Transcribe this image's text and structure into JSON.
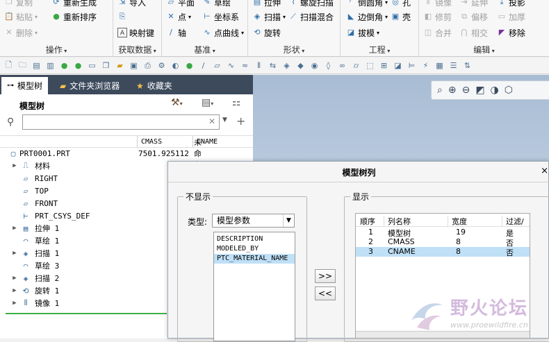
{
  "ribbon": {
    "groups": [
      {
        "label": "操作",
        "buttons": [
          {
            "label": "复制",
            "icon": "copy-icon",
            "disabled": true
          },
          {
            "label": "粘贴",
            "icon": "paste-icon",
            "disabled": true
          },
          {
            "label": "删除",
            "icon": "delete-icon",
            "disabled": true
          },
          {
            "label": "重新生成",
            "icon": "regenerate-icon",
            "disabled": false
          },
          {
            "label": "重新排序",
            "icon": "reorder-icon",
            "disabled": false
          }
        ]
      },
      {
        "label": "获取数据",
        "buttons": [
          {
            "label": "导入",
            "icon": "import-icon"
          },
          {
            "label": "",
            "icon": "data-icon"
          },
          {
            "label": "映射键",
            "icon": "mapkey-icon"
          }
        ]
      },
      {
        "label": "基准",
        "buttons": [
          {
            "label": "平面",
            "icon": "plane-icon"
          },
          {
            "label": "点",
            "icon": "point-icon"
          },
          {
            "label": "轴",
            "icon": "axis-icon"
          },
          {
            "label": "草绘",
            "icon": "sketch-icon"
          },
          {
            "label": "坐标系",
            "icon": "csys-icon"
          },
          {
            "label": "点曲线",
            "icon": "curve-icon"
          }
        ]
      },
      {
        "label": "形状",
        "buttons": [
          {
            "label": "拉伸",
            "icon": "extrude-icon"
          },
          {
            "label": "扫描",
            "icon": "sweep-icon"
          },
          {
            "label": "旋转",
            "icon": "revolve-icon"
          },
          {
            "label": "螺旋扫描",
            "icon": "helical-sweep-icon"
          },
          {
            "label": "扫描混合",
            "icon": "swept-blend-icon"
          }
        ]
      },
      {
        "label": "工程",
        "buttons": [
          {
            "label": "倒圆角",
            "icon": "round-icon"
          },
          {
            "label": "边倒角",
            "icon": "chamfer-icon"
          },
          {
            "label": "拔模",
            "icon": "draft-icon"
          },
          {
            "label": "孔",
            "icon": "hole-icon"
          },
          {
            "label": "壳",
            "icon": "shell-icon"
          }
        ]
      },
      {
        "label": "编辑",
        "buttons": [
          {
            "label": "镜像",
            "icon": "mirror-icon",
            "disabled": true
          },
          {
            "label": "修剪",
            "icon": "trim-icon",
            "disabled": true
          },
          {
            "label": "合并",
            "icon": "merge-icon",
            "disabled": true
          },
          {
            "label": "延伸",
            "icon": "extend-icon",
            "disabled": true
          },
          {
            "label": "偏移",
            "icon": "offset-icon",
            "disabled": true
          },
          {
            "label": "相交",
            "icon": "intersect-icon",
            "disabled": true
          },
          {
            "label": "投影",
            "icon": "project-icon",
            "disabled": false
          },
          {
            "label": "加厚",
            "icon": "thicken-icon",
            "disabled": true
          },
          {
            "label": "移除",
            "icon": "remove-icon",
            "disabled": false
          }
        ]
      }
    ]
  },
  "panel": {
    "tabs": [
      "模型树",
      "文件夹浏览器",
      "收藏夹"
    ],
    "tree_title": "模型树",
    "columns": [
      "CMASS",
      "CNAME"
    ],
    "root": {
      "name": "PRT0001.PRT",
      "cmass": "7501.925112",
      "cname": "未命名"
    },
    "items": [
      {
        "name": "材料",
        "icon": "material-icon",
        "expandable": true
      },
      {
        "name": "RIGHT",
        "icon": "datum-plane-icon",
        "expandable": false
      },
      {
        "name": "TOP",
        "icon": "datum-plane-icon",
        "expandable": false
      },
      {
        "name": "FRONT",
        "icon": "datum-plane-icon",
        "expandable": false
      },
      {
        "name": "PRT_CSYS_DEF",
        "icon": "csys-icon",
        "expandable": false
      },
      {
        "name": "拉伸 1",
        "icon": "extrude-icon",
        "expandable": true
      },
      {
        "name": "草绘 1",
        "icon": "sketch-icon",
        "expandable": false
      },
      {
        "name": "扫描 1",
        "icon": "sweep-icon",
        "expandable": true
      },
      {
        "name": "草绘 3",
        "icon": "sketch-icon",
        "expandable": false
      },
      {
        "name": "扫描 2",
        "icon": "sweep-icon",
        "expandable": true
      },
      {
        "name": "旋转 1",
        "icon": "revolve-icon",
        "expandable": true
      },
      {
        "name": "镜像 1",
        "icon": "mirror-icon",
        "expandable": true
      }
    ]
  },
  "dialog": {
    "title": "模型树列",
    "hidden_legend": "不显示",
    "type_label": "类型:",
    "type_value": "模型参数",
    "params": [
      "DESCRIPTION",
      "MODELED_BY",
      "PTC_MATERIAL_NAME"
    ],
    "selected_param": 2,
    "display_legend": "显示",
    "add_label": ">>",
    "remove_label": "<<",
    "table_headers": [
      "顺序",
      "列名称",
      "宽度",
      "过滤/"
    ],
    "rows": [
      {
        "order": "1",
        "name": "模型树",
        "width": "19",
        "filter": "是"
      },
      {
        "order": "2",
        "name": "CMASS",
        "width": "8",
        "filter": "否"
      },
      {
        "order": "3",
        "name": "CNAME",
        "width": "8",
        "filter": "否"
      }
    ],
    "selected_row": 2
  },
  "watermark": {
    "text": "野火论坛",
    "url": "www.proewildfire.cn"
  },
  "colors": {
    "accent": "#2f6ea8",
    "selection": "#bfe0f7",
    "tab_dark": "#3c4a5c",
    "tree_divider": "#3cb043"
  }
}
